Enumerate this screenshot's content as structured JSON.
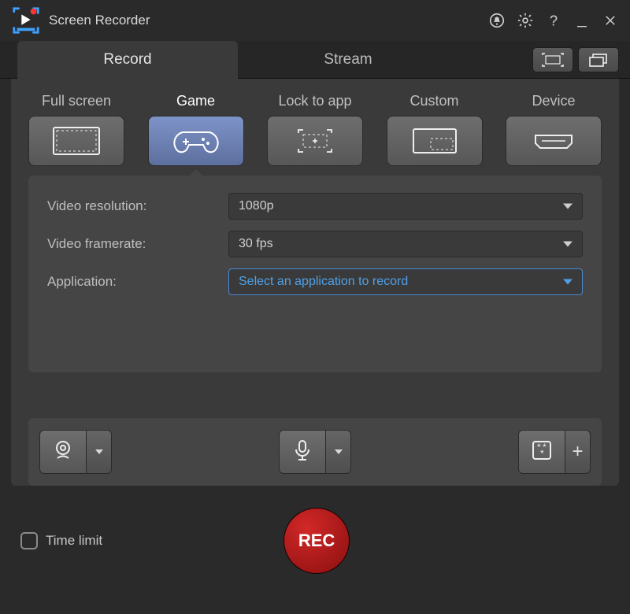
{
  "title": "Screen Recorder",
  "tabs": {
    "record": "Record",
    "stream": "Stream"
  },
  "modes": [
    {
      "id": "fullscreen",
      "label": "Full screen"
    },
    {
      "id": "game",
      "label": "Game"
    },
    {
      "id": "lock",
      "label": "Lock to app"
    },
    {
      "id": "custom",
      "label": "Custom"
    },
    {
      "id": "device",
      "label": "Device"
    }
  ],
  "settings": {
    "resolution_label": "Video resolution:",
    "resolution_value": "1080p",
    "framerate_label": "Video framerate:",
    "framerate_value": "30 fps",
    "application_label": "Application:",
    "application_value": "Select an application to record"
  },
  "footer": {
    "time_limit_label": "Time limit",
    "rec_label": "REC"
  }
}
